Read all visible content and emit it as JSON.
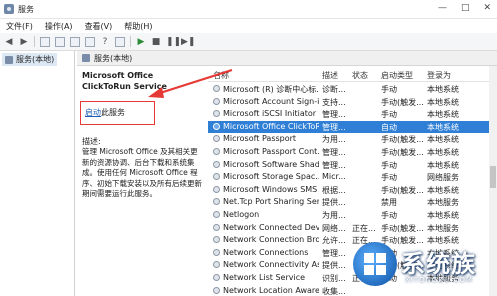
{
  "window": {
    "title": "服务",
    "controls": [
      "—",
      "□",
      "✕"
    ]
  },
  "menu": [
    "文件(F)",
    "操作(A)",
    "查看(V)",
    "帮助(H)"
  ],
  "tree": {
    "item": "服务(本地)"
  },
  "pane_header": "服务(本地)",
  "description": {
    "service_name": "Microsoft Office ClickToRun Service",
    "start_link": "启动",
    "start_suffix": "此服务",
    "label": "描述:",
    "text": "管理 Microsoft Office 及其相关更新的资源协调、后台下载和系统集成。使用任何 Microsoft Office 程序、初始下载安装以及所有后续更新期间需要运行此服务。"
  },
  "columns": [
    "名称",
    "描述",
    "状态",
    "启动类型",
    "登录为"
  ],
  "rows": [
    {
      "name": "Microsoft (R) 诊断中心标...",
      "desc": "诊断...",
      "status": "",
      "startup": "手动",
      "logon": "本地系统"
    },
    {
      "name": "Microsoft Account Sign-in ...",
      "desc": "支持...",
      "status": "",
      "startup": "手动(触发...",
      "logon": "本地系统"
    },
    {
      "name": "Microsoft iSCSI Initiator ...",
      "desc": "管理...",
      "status": "",
      "startup": "手动",
      "logon": "本地系统"
    },
    {
      "name": "Microsoft Office ClickToRu...",
      "desc": "管理...",
      "status": "",
      "startup": "自动",
      "logon": "本地系统",
      "selected": true
    },
    {
      "name": "Microsoft Passport",
      "desc": "为用...",
      "status": "",
      "startup": "手动(触发...",
      "logon": "本地系统"
    },
    {
      "name": "Microsoft Passport Cont...",
      "desc": "管理...",
      "status": "",
      "startup": "手动(触发...",
      "logon": "本地系统"
    },
    {
      "name": "Microsoft Software Shad...",
      "desc": "管理...",
      "status": "",
      "startup": "手动",
      "logon": "本地系统"
    },
    {
      "name": "Microsoft Storage Spac...",
      "desc": "Micr...",
      "status": "",
      "startup": "手动",
      "logon": "网络服务"
    },
    {
      "name": "Microsoft Windows SMS ...",
      "desc": "根据...",
      "status": "",
      "startup": "手动(触发...",
      "logon": "本地系统"
    },
    {
      "name": "Net.Tcp Port Sharing Ser...",
      "desc": "提供...",
      "status": "",
      "startup": "禁用",
      "logon": "本地服务"
    },
    {
      "name": "Netlogon",
      "desc": "为用...",
      "status": "",
      "startup": "手动",
      "logon": "本地系统"
    },
    {
      "name": "Network Connected Devi...",
      "desc": "网络...",
      "status": "正在...",
      "startup": "手动(触发...",
      "logon": "本地服务"
    },
    {
      "name": "Network Connection Bro...",
      "desc": "允许...",
      "status": "正在...",
      "startup": "手动(触发...",
      "logon": "本地系统"
    },
    {
      "name": "Network Connections",
      "desc": "管理...",
      "status": "",
      "startup": "手动",
      "logon": "本地系统"
    },
    {
      "name": "Network Connectivity Ass...",
      "desc": "提供...",
      "status": "",
      "startup": "手动(触发...",
      "logon": "本地系统"
    },
    {
      "name": "Network List Service",
      "desc": "识别...",
      "status": "正在...",
      "startup": "手动",
      "logon": "本地服务"
    },
    {
      "name": "Network Location Aware...",
      "desc": "收集...",
      "status": "",
      "startup": "",
      "logon": ""
    }
  ],
  "watermark": {
    "text": "系统族",
    "url": "XITONGZU.COM"
  },
  "colors": {
    "selection": "#2f7fd6",
    "highlight_box": "#e53935",
    "arrow": "#e53935"
  }
}
